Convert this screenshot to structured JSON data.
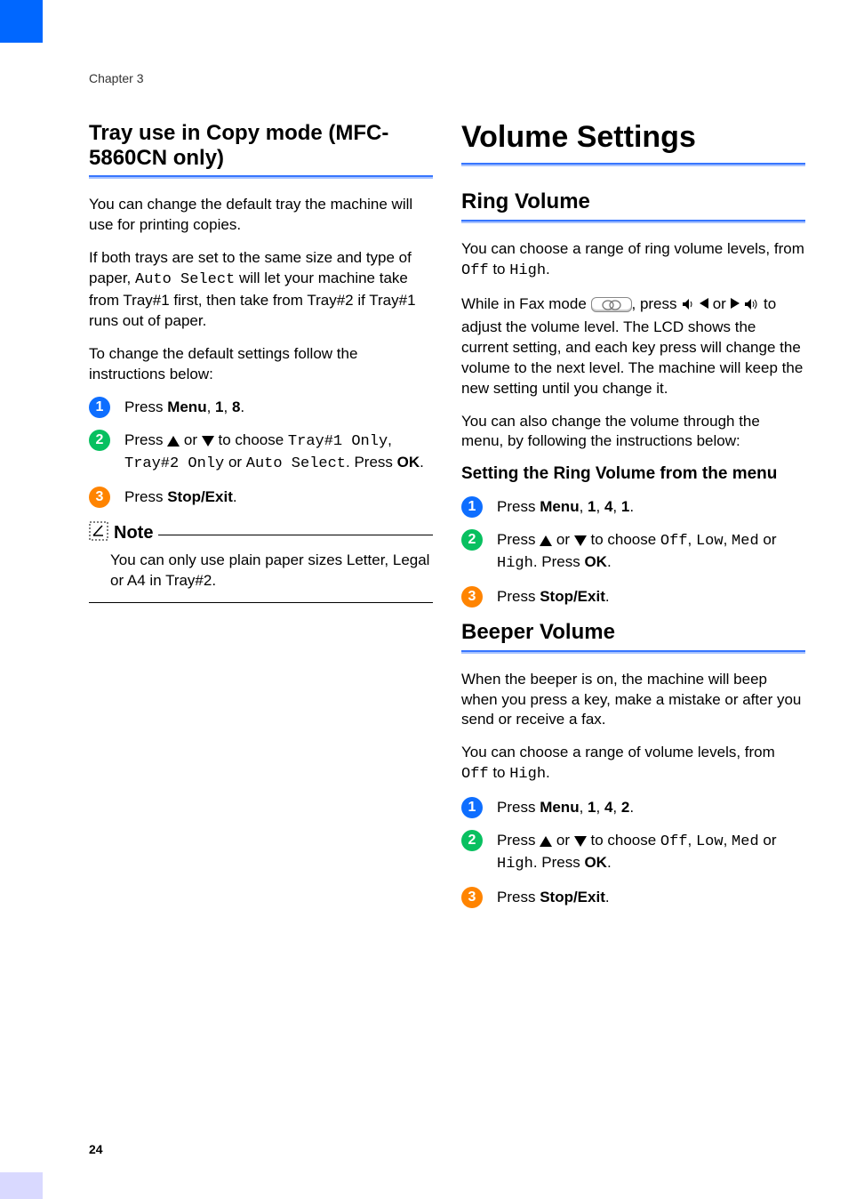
{
  "chapter": "Chapter 3",
  "page_number": "24",
  "left": {
    "h2": "Tray use in Copy mode (MFC-5860CN only)",
    "p1": "You can change the default tray the machine will use for printing copies.",
    "p2_a": "If both trays are set to the same size and type of paper, ",
    "p2_mono": "Auto Select",
    "p2_b": " will let your machine take from Tray#1 first, then take from Tray#2 if Tray#1 runs out of paper.",
    "p3": "To change the default settings follow the instructions below:",
    "step1_a": "Press ",
    "step1_b": "Menu",
    "step1_c": ", ",
    "step1_d": "1",
    "step1_e": ", ",
    "step1_f": "8",
    "step1_g": ".",
    "step2_a": "Press ",
    "step2_b": " or ",
    "step2_c": " to choose ",
    "step2_m1": "Tray#1 Only",
    "step2_d": ", ",
    "step2_m2": "Tray#2 Only",
    "step2_e": " or ",
    "step2_m3": "Auto Select",
    "step2_f": ". Press ",
    "step2_ok": "OK",
    "step2_g": ".",
    "step3_a": "Press ",
    "step3_b": "Stop/Exit",
    "step3_c": ".",
    "note_label": "Note",
    "note_body": "You can only use plain paper sizes Letter, Legal or A4 in Tray#2."
  },
  "right": {
    "h1": "Volume Settings",
    "ring": {
      "h2": "Ring Volume",
      "p1_a": "You can choose a range of ring volume levels, from ",
      "p1_m1": "Off",
      "p1_b": " to ",
      "p1_m2": "High",
      "p1_c": ".",
      "p2_a": "While in Fax mode ",
      "p2_b": ", press ",
      "p2_c": " or ",
      "p2_d": " to adjust the volume level. The LCD shows the current setting, and each key press will change the volume to the next level. The machine will keep the new setting until you change it.",
      "p3": "You can also change the volume through the menu, by following the instructions below:",
      "subhead": "Setting the Ring Volume from the menu",
      "s1_a": "Press ",
      "s1_b": "Menu",
      "s1_c": ", ",
      "s1_d": "1",
      "s1_e": ", ",
      "s1_f": "4",
      "s1_g": ", ",
      "s1_h": "1",
      "s1_i": ".",
      "s2_a": "Press ",
      "s2_b": " or ",
      "s2_c": " to choose ",
      "s2_m1": "Off",
      "s2_d": ", ",
      "s2_m2": "Low",
      "s2_e": ", ",
      "s2_m3": "Med",
      "s2_f": " or ",
      "s2_m4": "High",
      "s2_g": ". Press ",
      "s2_ok": "OK",
      "s2_h": ".",
      "s3_a": "Press ",
      "s3_b": "Stop/Exit",
      "s3_c": "."
    },
    "beeper": {
      "h2": "Beeper Volume",
      "p1": "When the beeper is on, the machine will beep when you press a key, make a mistake or after you send or receive a fax.",
      "p2_a": "You can choose a range of volume levels, from ",
      "p2_m1": "Off",
      "p2_b": " to ",
      "p2_m2": "High",
      "p2_c": ".",
      "s1_a": "Press ",
      "s1_b": "Menu",
      "s1_c": ", ",
      "s1_d": "1",
      "s1_e": ", ",
      "s1_f": "4",
      "s1_g": ", ",
      "s1_h": "2",
      "s1_i": ".",
      "s2_a": "Press ",
      "s2_b": " or ",
      "s2_c": " to choose ",
      "s2_m1": "Off",
      "s2_d": ", ",
      "s2_m2": "Low",
      "s2_e": ", ",
      "s2_m3": "Med",
      "s2_f": " or ",
      "s2_m4": "High",
      "s2_g": ". Press ",
      "s2_ok": "OK",
      "s2_h": ".",
      "s3_a": "Press ",
      "s3_b": "Stop/Exit",
      "s3_c": "."
    }
  }
}
